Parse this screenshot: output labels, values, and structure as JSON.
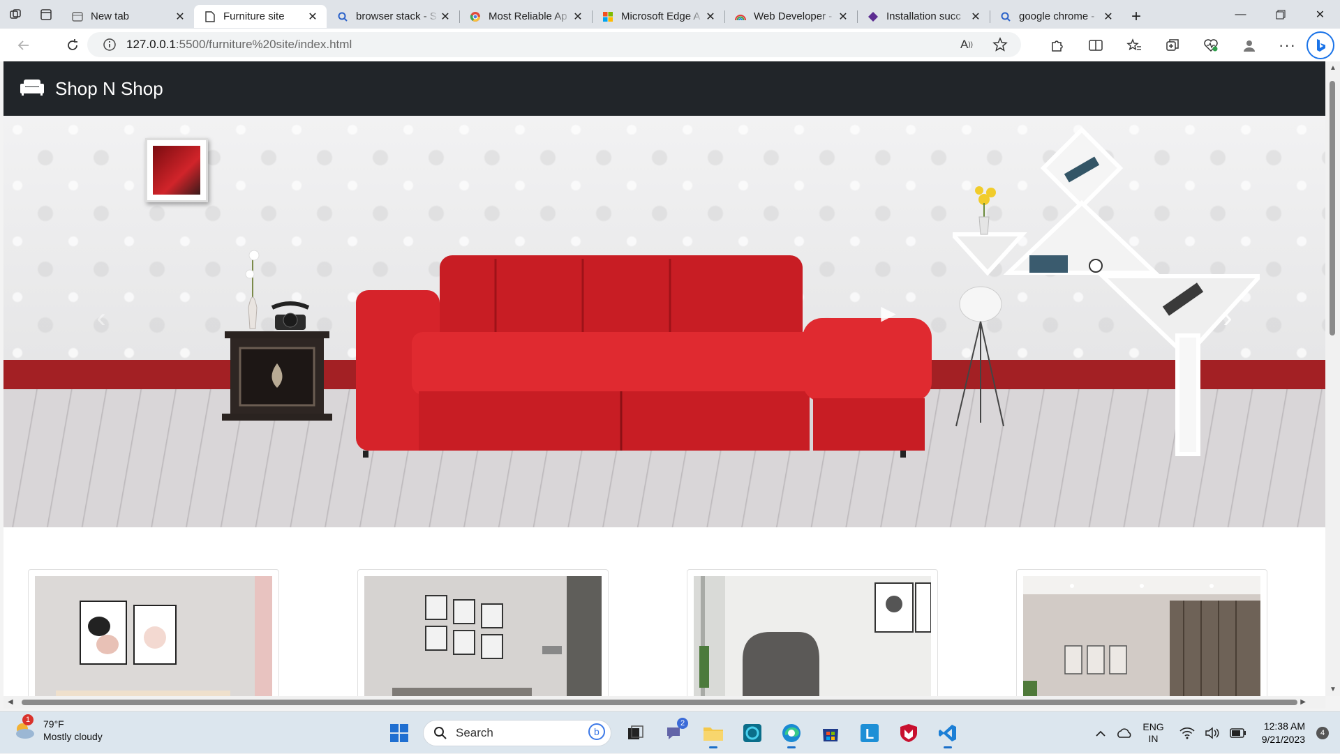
{
  "browser": {
    "tabs": [
      {
        "title": "New tab",
        "favicon": "new-tab-icon",
        "active": false
      },
      {
        "title": "Furniture site",
        "favicon": "page-icon",
        "active": true
      },
      {
        "title": "browser stack - S",
        "favicon": "search-icon",
        "active": false
      },
      {
        "title": "Most Reliable Ap",
        "favicon": "chrome-icon",
        "active": false
      },
      {
        "title": "Microsoft Edge A",
        "favicon": "microsoft-icon",
        "active": false
      },
      {
        "title": "Web Developer -",
        "favicon": "rainbow-icon",
        "active": false
      },
      {
        "title": "Installation succ",
        "favicon": "visual-studio-icon",
        "active": false
      },
      {
        "title": "google chrome -",
        "favicon": "search-icon",
        "active": false
      }
    ],
    "address": {
      "host": "127.0.0.1",
      "path": ":5500/furniture%20site/index.html"
    }
  },
  "site": {
    "brand": "Shop N Shop",
    "brand_icon": "couch-icon",
    "hero": {
      "wall_stripe_color": "#a32024",
      "sofa_color": "#d91f27"
    },
    "cards": [
      {
        "name": "living-room-art-frames"
      },
      {
        "name": "living-room-gallery-wall"
      },
      {
        "name": "armchair-corner"
      },
      {
        "name": "modern-living-room"
      }
    ]
  },
  "taskbar": {
    "weather": {
      "temp": "79°F",
      "condition": "Mostly cloudy",
      "alert_count": "1"
    },
    "search_label": "Search",
    "teams_badge": "2",
    "lang_top": "ENG",
    "lang_bottom": "IN",
    "time": "12:38 AM",
    "date": "9/21/2023",
    "notifications": "4"
  }
}
